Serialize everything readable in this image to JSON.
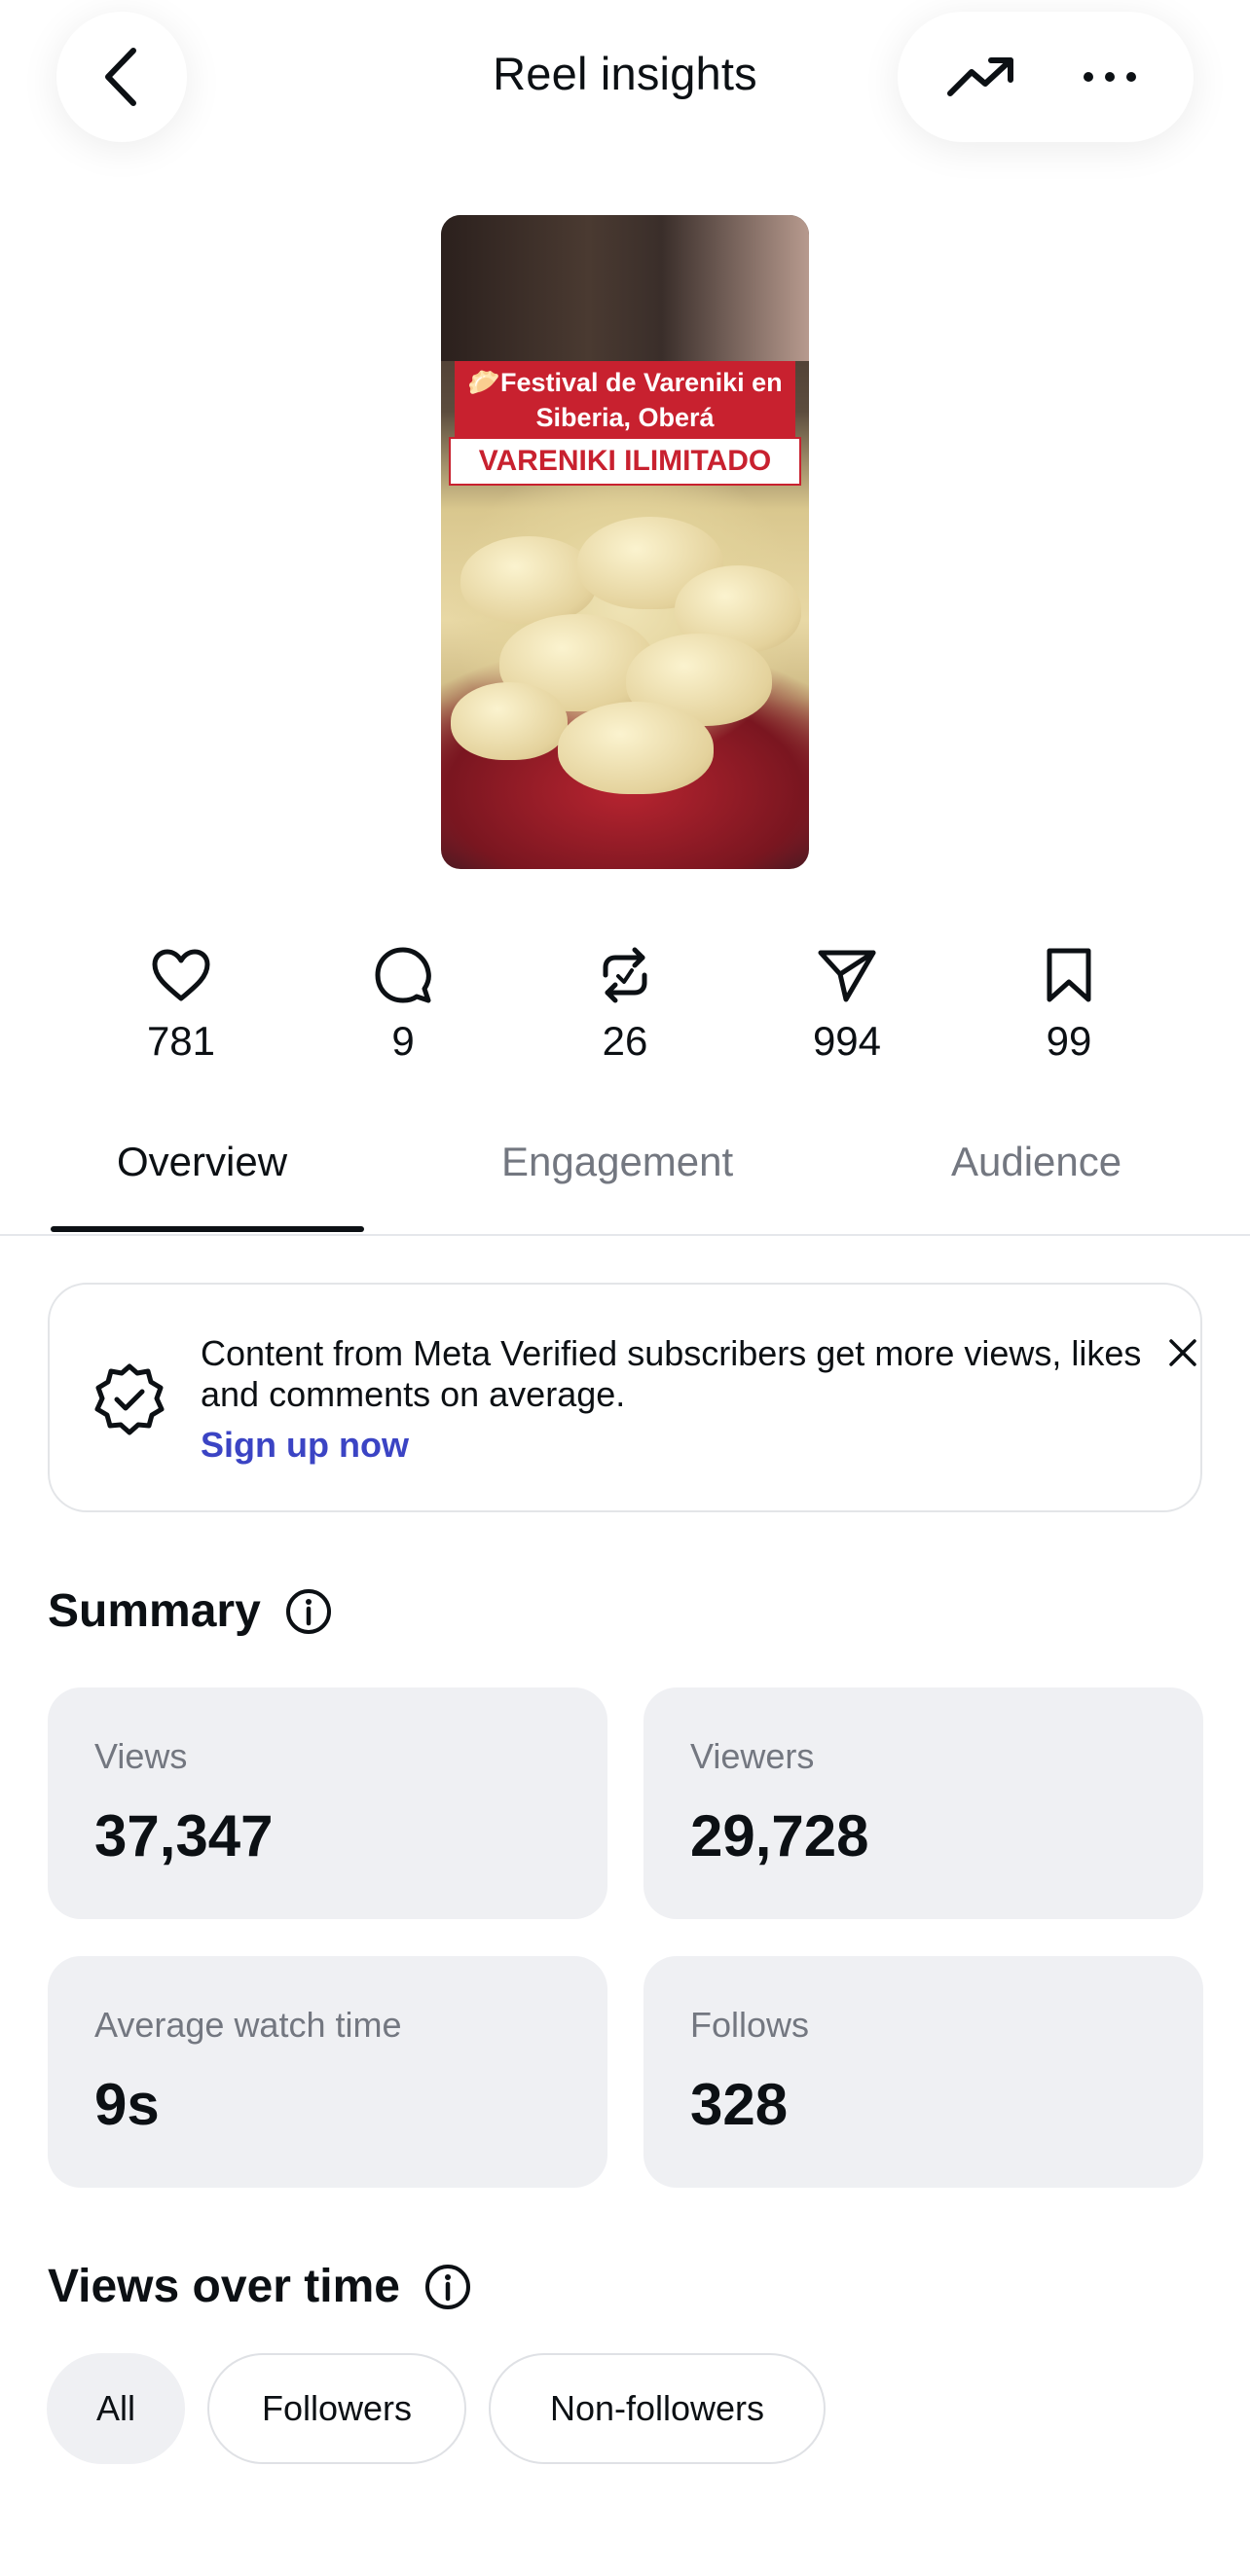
{
  "header": {
    "title": "Reel insights"
  },
  "thumbnail": {
    "caption_line1": "🥟Festival de Vareniki en Siberia, Oberá",
    "caption_line2": "VARENIKI ILIMITADO"
  },
  "stats": [
    {
      "icon": "heart-icon",
      "value": "781"
    },
    {
      "icon": "comment-icon",
      "value": "9"
    },
    {
      "icon": "repost-icon",
      "value": "26"
    },
    {
      "icon": "share-icon",
      "value": "994"
    },
    {
      "icon": "bookmark-icon",
      "value": "99"
    }
  ],
  "tabs": [
    {
      "label": "Overview",
      "active": true
    },
    {
      "label": "Engagement",
      "active": false
    },
    {
      "label": "Audience",
      "active": false
    }
  ],
  "notice": {
    "text": "Content from Meta Verified subscribers get more views, likes and comments on average.",
    "link": "Sign up now"
  },
  "summary": {
    "title": "Summary",
    "cards": [
      {
        "label": "Views",
        "value": "37,347"
      },
      {
        "label": "Viewers",
        "value": "29,728"
      },
      {
        "label": "Average watch time",
        "value": "9s"
      },
      {
        "label": "Follows",
        "value": "328"
      }
    ]
  },
  "views_over_time": {
    "title": "Views over time",
    "filters": [
      {
        "label": "All",
        "selected": true
      },
      {
        "label": "Followers",
        "selected": false
      },
      {
        "label": "Non-followers",
        "selected": false
      }
    ]
  },
  "colors": {
    "accent_link": "#3b44c4",
    "card_bg": "#eff0f3",
    "text_secondary": "#737780"
  }
}
